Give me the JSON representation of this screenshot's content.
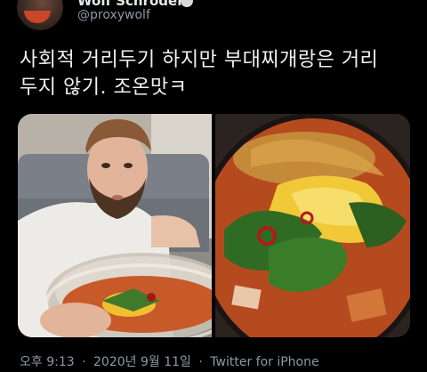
{
  "tweet": {
    "display_name": "Wolf Schröder",
    "handle": "@proxywolf",
    "text_lines": [
      "사회적 거리두기 하지만 부대찌개랑은 거리",
      "두지 않기. 조온맛ㅋ"
    ],
    "time": "오후 9:13",
    "separator": "·",
    "date": "2020년 9월 11일",
    "source": "Twitter for iPhone"
  },
  "media": {
    "photos": [
      {
        "subject": "man-with-stew-bowl-photo"
      },
      {
        "subject": "budae-jjigae-closeup-photo"
      }
    ]
  },
  "icons": {
    "verified": "verified-badge-icon"
  },
  "colors": {
    "background": "#000000",
    "text": "#e7e9ea",
    "secondary_text": "#8b98a5"
  }
}
